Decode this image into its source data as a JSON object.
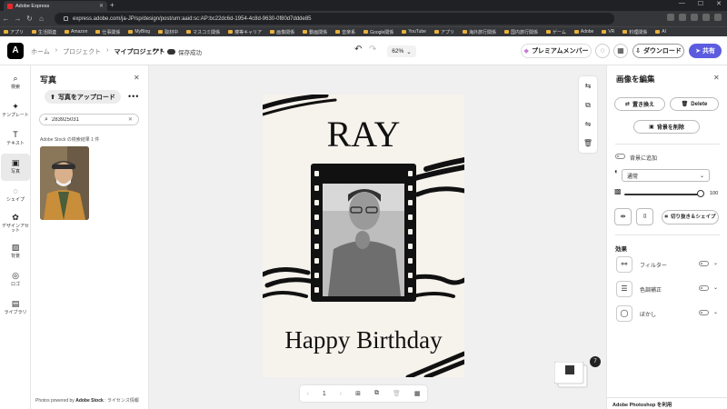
{
  "browser": {
    "tab_title": "Adobe Express",
    "url": "express.adobe.com/ja-JP/sp/design/post/urn:aaid:sc:AP:bc22dc6d-1954-4c8d-9630-0f80d7ddde85",
    "bookmarks": [
      "アプリ",
      "生活関連",
      "Amazon",
      "仕事関係",
      "MyBlog",
      "取材中",
      "マスコミ関係",
      "痩等キャリア",
      "画像関係",
      "動画関係",
      "音楽系",
      "Google関係",
      "YouTube",
      "アプリ",
      "海外旅行関係",
      "国内旅行関係",
      "ゲーム",
      "Adobe",
      "VR",
      "料理関係",
      "AI"
    ]
  },
  "header": {
    "logo": "A",
    "crumbs": [
      "ホーム",
      "プロジェクト",
      "マイプロジェクト"
    ],
    "more": "•••",
    "saved": "保存成功",
    "zoom": "62%",
    "premium": "プレミアムメンバー",
    "download": "ダウンロード",
    "share": "共有"
  },
  "rail": [
    {
      "label": "検索",
      "icon": "search-icon",
      "glyph": "⌕"
    },
    {
      "label": "テンプレート",
      "icon": "template-icon",
      "glyph": "✦"
    },
    {
      "label": "テキスト",
      "icon": "text-icon",
      "glyph": "T"
    },
    {
      "label": "写真",
      "icon": "photo-icon",
      "glyph": "▣"
    },
    {
      "label": "シェイプ",
      "icon": "shape-icon",
      "glyph": "◌"
    },
    {
      "label": "デザインアセット",
      "icon": "design-assets-icon",
      "glyph": "✿"
    },
    {
      "label": "背景",
      "icon": "background-icon",
      "glyph": "▨"
    },
    {
      "label": "ロゴ",
      "icon": "logo-icon",
      "glyph": "◎"
    },
    {
      "label": "ライブラリ",
      "icon": "library-icon",
      "glyph": "▤"
    }
  ],
  "panel": {
    "title": "写真",
    "upload": "写真をアップロード",
    "more": "•••",
    "search_value": "283925031",
    "results": "Adobe Stock の検索結果 1 件",
    "credit_prefix": "Photos powered by ",
    "credit_brand": "Adobe Stock",
    "credit_suffix": " : ライセンス情報"
  },
  "card": {
    "name": "RAY",
    "greeting": "Happy Birthday"
  },
  "pager": {
    "page": "1"
  },
  "badge": "7",
  "right": {
    "title": "画像を編集",
    "replace": "置き換え",
    "delete": "Delete",
    "remove_bg": "背景を削除",
    "add_bg": "背景に追加",
    "blend": "通常",
    "opacity": "100",
    "crop": "切り抜き＆シェイプ",
    "effects_title": "効果",
    "effects": [
      "フィルター",
      "色調補正",
      "ぼかし"
    ],
    "photoshop": "Adobe Photoshop を利用"
  }
}
